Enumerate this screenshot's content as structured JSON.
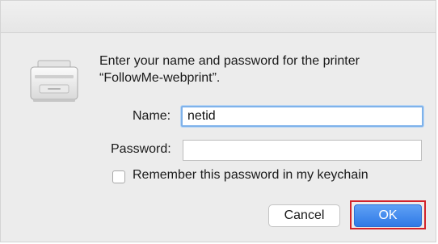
{
  "dialog": {
    "prompt_line1": "Enter your name and password for the printer",
    "prompt_line2": "“FollowMe-webprint”."
  },
  "form": {
    "name_label": "Name:",
    "name_value": "netid",
    "password_label": "Password:",
    "password_value": ""
  },
  "remember": {
    "label": "Remember this password in my keychain",
    "checked": false
  },
  "buttons": {
    "cancel": "Cancel",
    "ok": "OK"
  },
  "colors": {
    "accent": "#3a84ec",
    "highlight_outline": "#d2232a",
    "focus_ring": "#7fb2ea"
  },
  "icons": {
    "dialog_icon": "printer-icon"
  }
}
